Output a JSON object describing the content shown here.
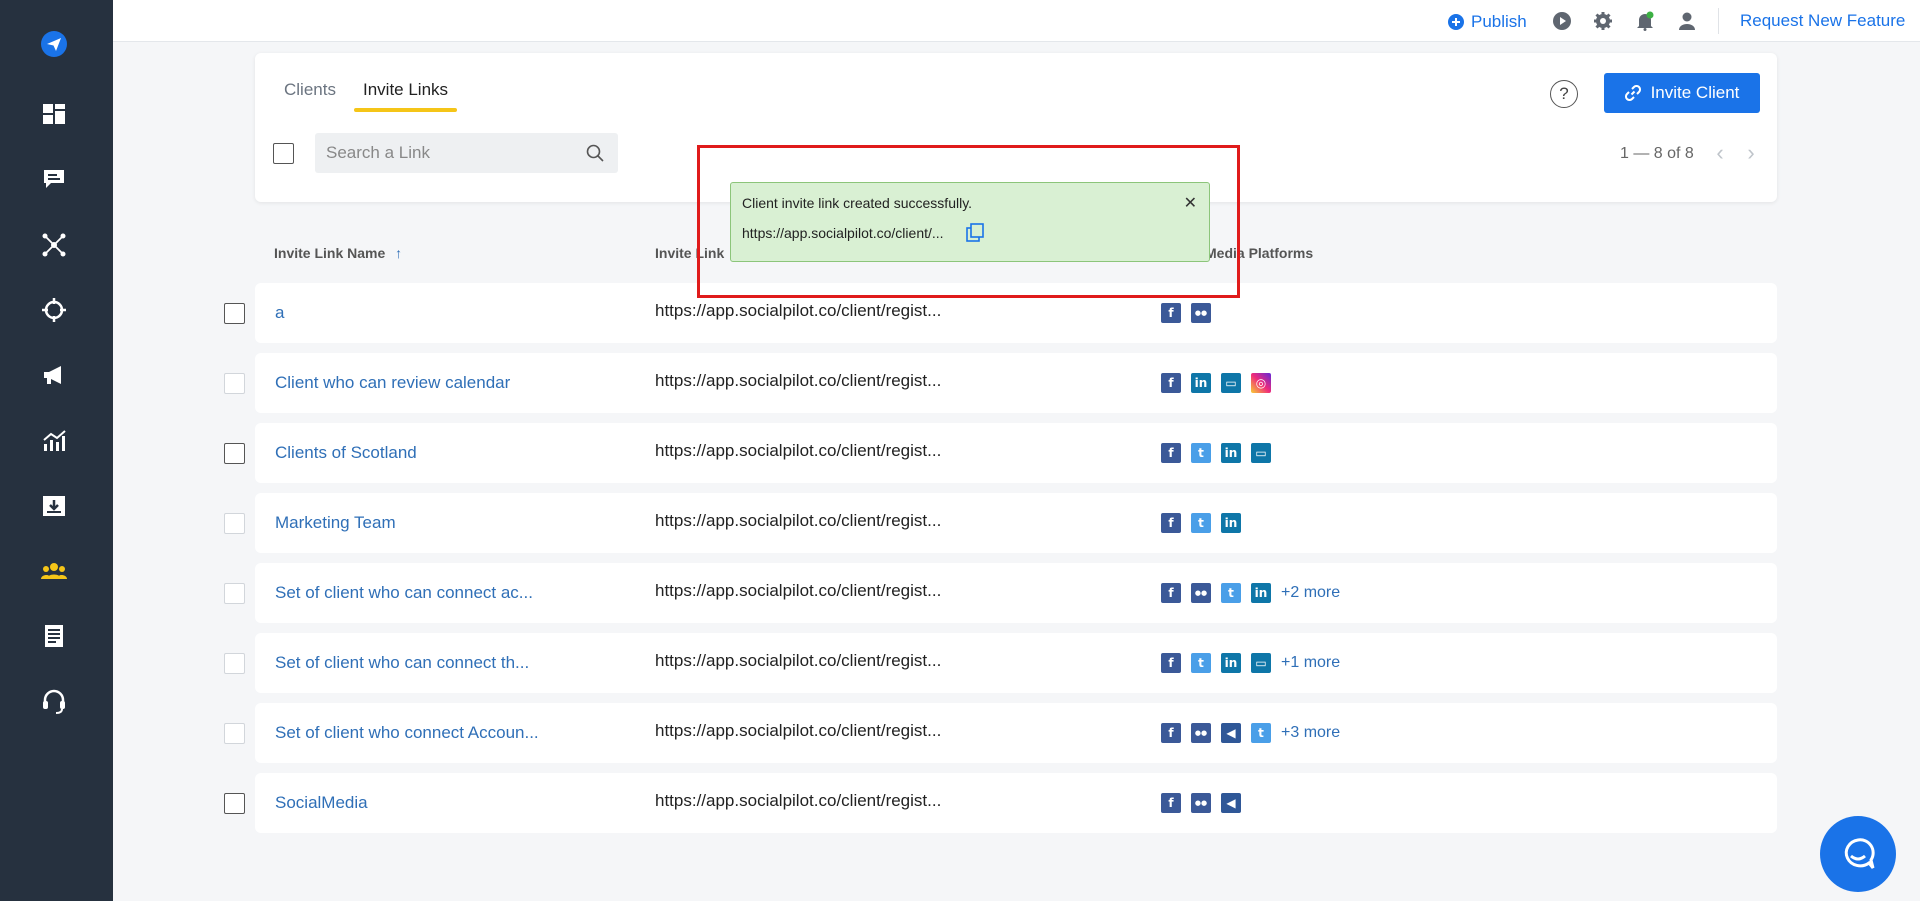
{
  "topbar": {
    "publish_label": "Publish",
    "request_label": "Request New Feature"
  },
  "tabs": [
    {
      "label": "Clients",
      "active": false
    },
    {
      "label": "Invite Links",
      "active": true
    }
  ],
  "header": {
    "help_label": "?",
    "invite_button_label": "Invite Client",
    "search_placeholder": "Search a Link",
    "pager_text": "1 — 8 of 8"
  },
  "columns": {
    "name": "Invite Link Name",
    "name_sort": "↑",
    "link": "Invite Link",
    "platforms": "Media Platforms"
  },
  "rows": [
    {
      "name": "a",
      "link": "https://app.socialpilot.co/client/regist...",
      "platforms": [
        "facebook",
        "facebook-group"
      ],
      "more": ""
    },
    {
      "name": "Client who can review calendar",
      "link": "https://app.socialpilot.co/client/regist...",
      "platforms": [
        "facebook",
        "linkedin",
        "google-business",
        "instagram"
      ],
      "more": ""
    },
    {
      "name": "Clients of Scotland",
      "link": "https://app.socialpilot.co/client/regist...",
      "platforms": [
        "facebook",
        "twitter",
        "linkedin",
        "google-business"
      ],
      "more": ""
    },
    {
      "name": "Marketing Team",
      "link": "https://app.socialpilot.co/client/regist...",
      "platforms": [
        "facebook",
        "twitter",
        "linkedin"
      ],
      "more": ""
    },
    {
      "name": "Set of client who can connect ac...",
      "link": "https://app.socialpilot.co/client/regist...",
      "platforms": [
        "facebook",
        "facebook-group",
        "twitter",
        "linkedin"
      ],
      "more": "+2 more"
    },
    {
      "name": "Set of client who can connect th...",
      "link": "https://app.socialpilot.co/client/regist...",
      "platforms": [
        "facebook",
        "twitter",
        "linkedin",
        "google-business"
      ],
      "more": "+1 more"
    },
    {
      "name": "Set of client who connect Accoun...",
      "link": "https://app.socialpilot.co/client/regist...",
      "platforms": [
        "facebook",
        "facebook-group",
        "facebook-ads",
        "twitter"
      ],
      "more": "+3 more"
    },
    {
      "name": "SocialMedia",
      "link": "https://app.socialpilot.co/client/regist...",
      "platforms": [
        "facebook",
        "facebook-group",
        "facebook-ads"
      ],
      "more": ""
    }
  ],
  "toast": {
    "message": "Client invite link created successfully.",
    "url": "https://app.socialpilot.co/client/...",
    "close_label": "✕"
  },
  "colors": {
    "sidebar": "#26313f",
    "accent": "#1a73e8",
    "tab_underline": "#f5c518",
    "toast_bg": "#d9f0d3",
    "highlight_frame": "#e01b1b",
    "active_nav": "#f5c518"
  }
}
